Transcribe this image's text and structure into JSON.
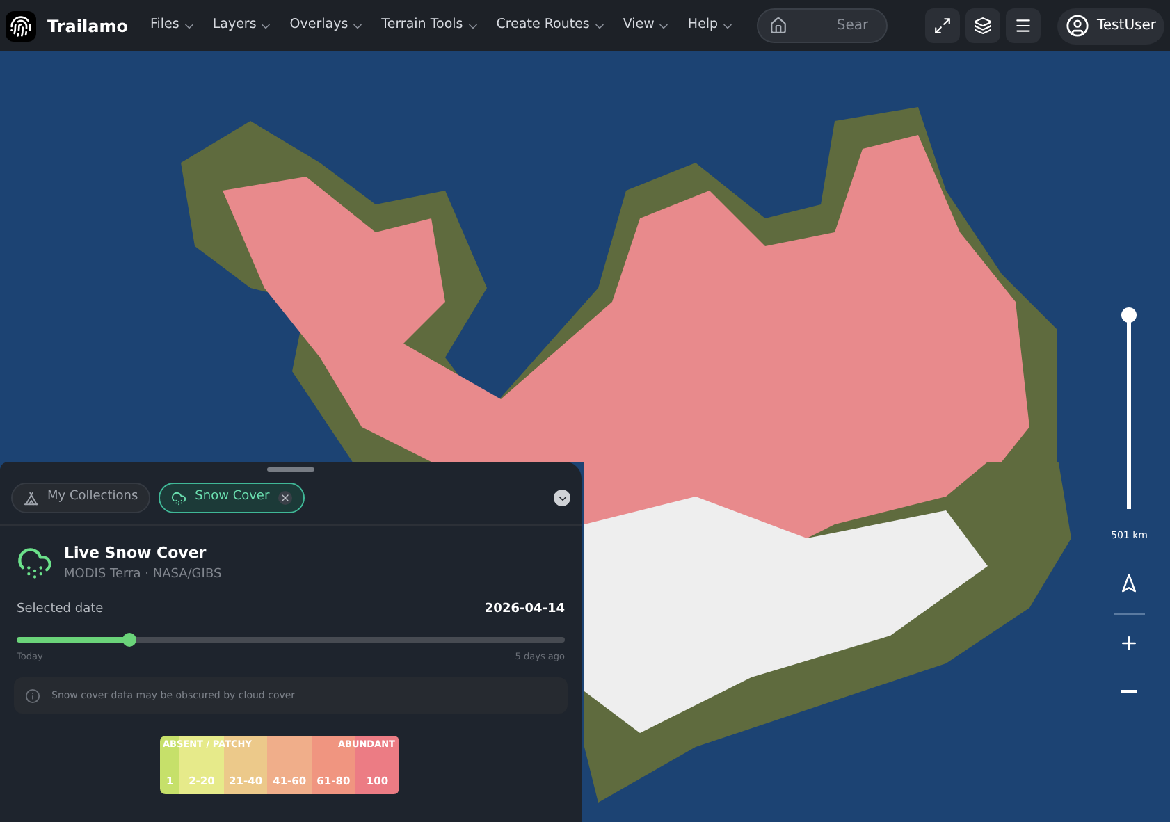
{
  "app": {
    "name": "Trailamo"
  },
  "menu": [
    {
      "label": "Files"
    },
    {
      "label": "Layers"
    },
    {
      "label": "Overlays"
    },
    {
      "label": "Terrain Tools"
    },
    {
      "label": "Create Routes"
    },
    {
      "label": "View"
    },
    {
      "label": "Help"
    }
  ],
  "search": {
    "placeholder": "Sear"
  },
  "user": {
    "name": "TestUser"
  },
  "panel": {
    "tabs": [
      {
        "label": "My Collections",
        "selected": false,
        "closable": false
      },
      {
        "label": "Snow Cover",
        "selected": true,
        "closable": true
      }
    ],
    "layer": {
      "title": "Live Snow Cover",
      "source": "MODIS Terra · NASA/GIBS"
    },
    "date": {
      "label": "Selected date",
      "value": "2026-04-14",
      "level": 0.205,
      "start": "Today",
      "end": "5 days ago"
    },
    "notice": "Snow cover data may be obscured by cloud cover",
    "legend": {
      "headers": [
        {
          "label": "ABSENT / PATCHY"
        },
        {
          "label": "ABUNDANT"
        }
      ],
      "bins": [
        {
          "label": "1",
          "color": "#c6e06a"
        },
        {
          "label": "2-20",
          "color": "#e6ea8a"
        },
        {
          "label": "21-40",
          "color": "#ecc98a"
        },
        {
          "label": "41-60",
          "color": "#f0ae8a"
        },
        {
          "label": "61-80",
          "color": "#f09580"
        },
        {
          "label": "100",
          "color": "#ec7c84"
        }
      ]
    }
  },
  "scale": {
    "level": 1,
    "reading": "501 km"
  }
}
